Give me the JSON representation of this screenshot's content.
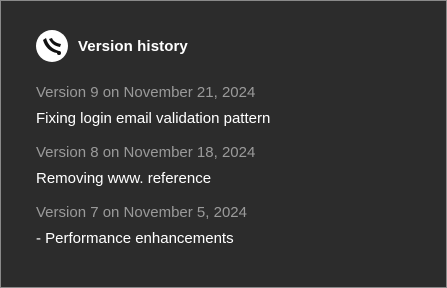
{
  "header": {
    "logo_icon": "scroll-quill-logo-icon",
    "title": "Version history"
  },
  "entries": [
    {
      "version_label": "Version 9 on November 21, 2024",
      "description": "Fixing login email validation pattern"
    },
    {
      "version_label": "Version 8 on November 18, 2024",
      "description": "Removing www. reference"
    },
    {
      "version_label": "Version 7 on November 5, 2024",
      "description": "- Performance enhancements"
    }
  ],
  "colors": {
    "panel_background": "#2c2c2c",
    "version_text": "#9a9a9a",
    "description_text": "#ffffff"
  }
}
